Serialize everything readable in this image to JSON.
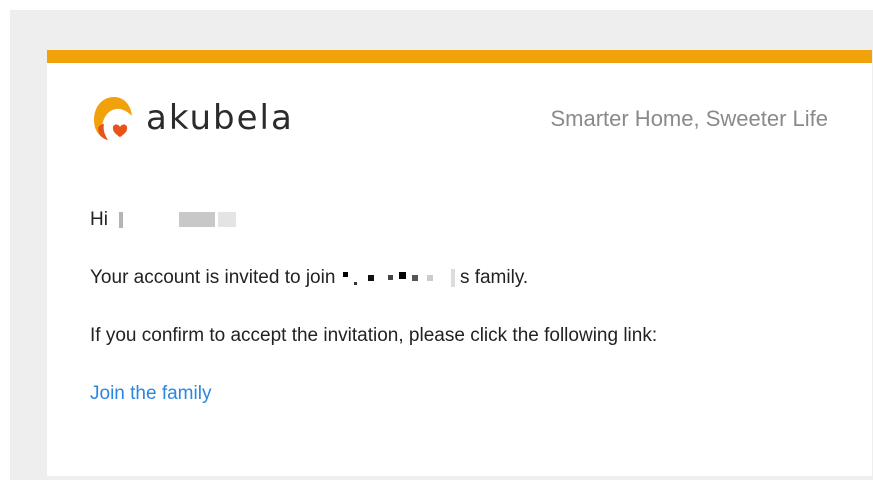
{
  "brand": {
    "logo_text": "akubela",
    "logo_icon": "akubela-logo-icon",
    "tagline": "Smarter Home, Sweeter Life",
    "accent_color": "#f1a20a"
  },
  "email": {
    "greeting_prefix": "Hi",
    "invite_prefix": "Your account is invited to join",
    "invite_suffix": "s family.",
    "confirm_text": "If you confirm to accept the invitation, please click the following link:",
    "link_text": "Join the family",
    "link_color": "#2b86e0"
  }
}
